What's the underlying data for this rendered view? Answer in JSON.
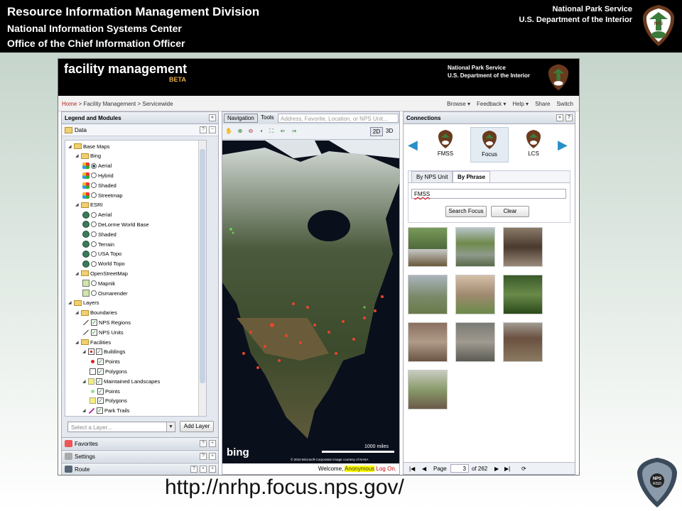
{
  "header": {
    "line1": "Resource Information Management Division",
    "line2": "National Information Systems Center",
    "line3": "Office of the Chief Information Officer",
    "right1": "National Park Service",
    "right2": "U.S. Department of the Interior",
    "logo_icon": "nps-arrowhead-logo-icon"
  },
  "app": {
    "title": "facility management",
    "badge": "BETA",
    "agency1": "National Park Service",
    "agency2": "U.S. Department of the Interior"
  },
  "breadcrumb": {
    "home": "Home",
    "rest": " > Facility Management > Servicewide"
  },
  "topmenu": [
    "Browse ▾",
    "Feedback ▾",
    "Help ▾",
    "Share",
    "Switch"
  ],
  "left": {
    "panel_title": "Legend and Modules",
    "data_title": "Data",
    "tree": [
      {
        "label": "Base Maps",
        "type": "folder",
        "level": 0
      },
      {
        "label": "Bing",
        "type": "folder",
        "level": 1
      },
      {
        "label": "Aerial",
        "type": "bing",
        "level": 2,
        "selected": true
      },
      {
        "label": "Hybrid",
        "type": "bing",
        "level": 2
      },
      {
        "label": "Shaded",
        "type": "bing",
        "level": 2
      },
      {
        "label": "Streetmap",
        "type": "bing",
        "level": 2
      },
      {
        "label": "ESRI",
        "type": "folder",
        "level": 1
      },
      {
        "label": "Aerial",
        "type": "esri",
        "level": 2
      },
      {
        "label": "DeLorme World Base",
        "type": "esri",
        "level": 2
      },
      {
        "label": "Shaded",
        "type": "esri",
        "level": 2
      },
      {
        "label": "Terrain",
        "type": "esri",
        "level": 2
      },
      {
        "label": "USA Topo",
        "type": "esri",
        "level": 2
      },
      {
        "label": "World Topo",
        "type": "esri",
        "level": 2
      },
      {
        "label": "OpenStreetMap",
        "type": "folder",
        "level": 1
      },
      {
        "label": "Mapnik",
        "type": "osm",
        "level": 2
      },
      {
        "label": "Osmarender",
        "type": "osm",
        "level": 2
      },
      {
        "label": "Layers",
        "type": "folder",
        "level": 0
      },
      {
        "label": "Boundaries",
        "type": "folder",
        "level": 1
      },
      {
        "label": "NPS Regions",
        "type": "check",
        "level": 2,
        "sym": "line"
      },
      {
        "label": "NPS Units",
        "type": "check",
        "level": 2,
        "sym": "line"
      },
      {
        "label": "Facilities",
        "type": "folder",
        "level": 1
      },
      {
        "label": "Buildings",
        "type": "checkx",
        "level": 2,
        "sym": "redbox"
      },
      {
        "label": "Points",
        "type": "check",
        "level": 3,
        "sym": "reddot"
      },
      {
        "label": "Polygons",
        "type": "check",
        "level": 3,
        "sym": "box"
      },
      {
        "label": "Maintained Landscapes",
        "type": "checkx",
        "level": 2,
        "sym": "yellow"
      },
      {
        "label": "Points",
        "type": "check",
        "level": 3,
        "sym": "greendot"
      },
      {
        "label": "Polygons",
        "type": "check",
        "level": 3,
        "sym": "yellow"
      },
      {
        "label": "Park Trails",
        "type": "checkx",
        "level": 2,
        "sym": "trail"
      }
    ],
    "select_placeholder": "Select a Layer...",
    "add_layer": "Add Layer",
    "accordion": [
      "Favorites",
      "Settings",
      "Route"
    ]
  },
  "map": {
    "tab_nav": "Navigation",
    "tab_tools": "Tools",
    "search_placeholder": "Address, Favorite, Location, or NPS Unit...",
    "mode_2d": "2D",
    "mode_3d": "3D",
    "scale": "1000 miles",
    "provider": "bing",
    "copyright": "© 2010 Microsoft Corporation   Image courtesy of NASA",
    "welcome": "Welcome, ",
    "user": "Anonymous",
    "logon": "Log On."
  },
  "right": {
    "panel_title": "Connections",
    "carousel": [
      "FMSS",
      "Focus",
      "LCS"
    ],
    "tab1": "By NPS Unit",
    "tab2": "By Phrase",
    "phrase_value": "FMSS",
    "search_btn": "Search Focus",
    "clear_btn": "Clear",
    "page_label": "Page",
    "page_value": "3",
    "page_total": "of 262"
  },
  "footer": {
    "url": "http://nrhp.focus.nps.gov/",
    "risd_label": "NPS RISD"
  }
}
